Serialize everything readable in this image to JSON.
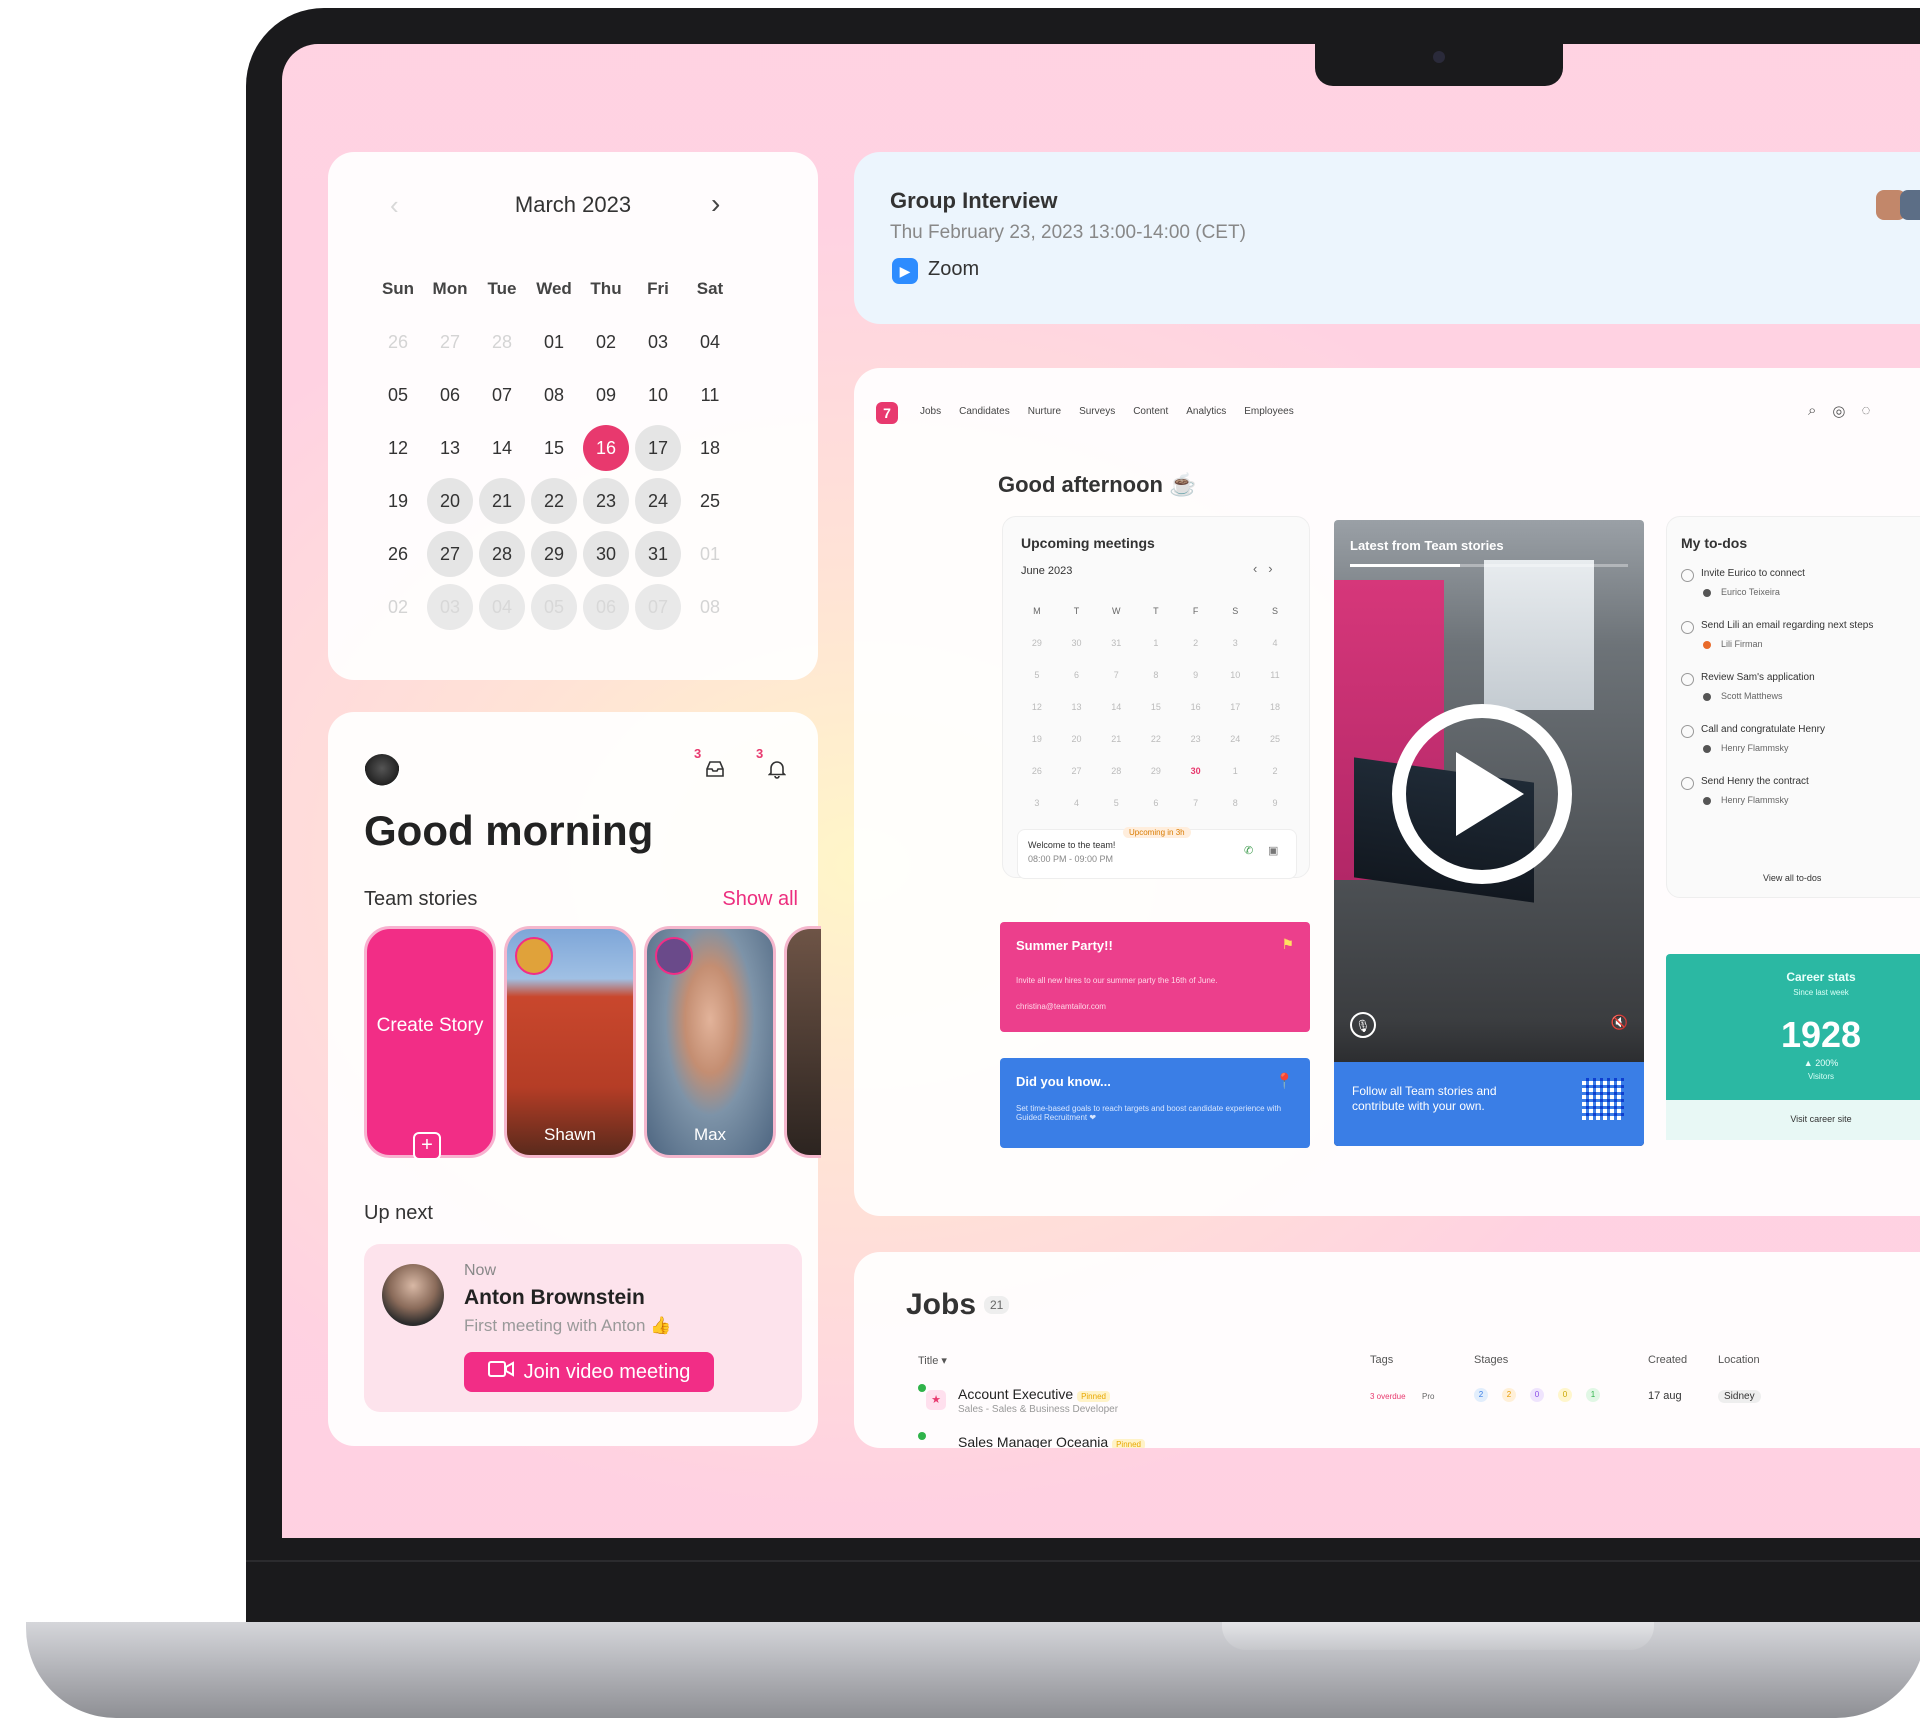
{
  "calendar": {
    "month": "March 2023",
    "weekdays": [
      "Sun",
      "Mon",
      "Tue",
      "Wed",
      "Thu",
      "Fri",
      "Sat"
    ],
    "weeks": [
      [
        "26",
        "27",
        "28",
        "01",
        "02",
        "03",
        "04"
      ],
      [
        "05",
        "06",
        "07",
        "08",
        "09",
        "10",
        "11"
      ],
      [
        "12",
        "13",
        "14",
        "15",
        "16",
        "17",
        "18"
      ],
      [
        "19",
        "20",
        "21",
        "22",
        "23",
        "24",
        "25"
      ],
      [
        "26",
        "27",
        "28",
        "29",
        "30",
        "31",
        "01"
      ],
      [
        "02",
        "03",
        "04",
        "05",
        "06",
        "07",
        "08"
      ]
    ],
    "selected": "16"
  },
  "home": {
    "notif_count_inbox": "3",
    "notif_count_bell": "3",
    "greeting": "Good morning",
    "stories_label": "Team stories",
    "show_all": "Show all",
    "create_story": "Create Story",
    "stories": [
      {
        "name": "Shawn"
      },
      {
        "name": "Max"
      }
    ],
    "up_next_label": "Up next",
    "up_next": {
      "when": "Now",
      "name": "Anton Brownstein",
      "subtitle": "First meeting with Anton 👍",
      "button": "Join video meeting"
    }
  },
  "meeting": {
    "title": "Group Interview",
    "time": "Thu February 23, 2023  13:00-14:00 (CET)",
    "platform": "Zoom"
  },
  "dashboard": {
    "logo": "7",
    "nav": [
      "Jobs",
      "Candidates",
      "Nurture",
      "Surveys",
      "Content",
      "Analytics",
      "Employees"
    ],
    "greeting": "Good afternoon ☕",
    "upcoming": {
      "title": "Upcoming meetings",
      "month": "June 2023",
      "weekdays": [
        "M",
        "T",
        "W",
        "T",
        "F",
        "S",
        "S"
      ],
      "weeks": [
        [
          "29",
          "30",
          "31",
          "1",
          "2",
          "3",
          "4"
        ],
        [
          "5",
          "6",
          "7",
          "8",
          "9",
          "10",
          "11"
        ],
        [
          "12",
          "13",
          "14",
          "15",
          "16",
          "17",
          "18"
        ],
        [
          "19",
          "20",
          "21",
          "22",
          "23",
          "24",
          "25"
        ],
        [
          "26",
          "27",
          "28",
          "29",
          "30",
          "1",
          "2"
        ],
        [
          "3",
          "4",
          "5",
          "6",
          "7",
          "8",
          "9"
        ]
      ],
      "highlight": "30",
      "badge": "Upcoming in 3h",
      "event_title": "Welcome to the team!",
      "event_time": "08:00 PM - 09:00 PM"
    },
    "summer": {
      "title": "Summer Party!!",
      "text": "Invite all new hires to our summer party the 16th of June.",
      "email": "christina@teamtailor.com"
    },
    "didyou": {
      "title": "Did you know...",
      "text": "Set time-based goals to reach targets and boost candidate experience with Guided Recruitment ❤"
    },
    "video": {
      "title": "Latest from Team stories",
      "footer": "Follow all Team stories and contribute with your own."
    },
    "todos": {
      "title": "My to-dos",
      "items": [
        {
          "text": "Invite Eurico to connect",
          "person": "Eurico Teixeira"
        },
        {
          "text": "Send Lili an email regarding next steps",
          "person": "Lili Firman"
        },
        {
          "text": "Review Sam's application",
          "person": "Scott Matthews"
        },
        {
          "text": "Call and congratulate Henry",
          "person": "Henry Flammsky"
        },
        {
          "text": "Send Henry the contract",
          "person": "Henry Flammsky"
        }
      ],
      "view_all": "View all to-dos"
    },
    "career": {
      "title": "Career stats",
      "subtitle": "Since last week",
      "value": "1928",
      "change": "▲ 200%",
      "unit": "Visitors",
      "link": "Visit career site"
    }
  },
  "jobs": {
    "title": "Jobs",
    "count": "21",
    "columns": [
      "Title ▾",
      "Tags",
      "Stages",
      "Created",
      "Location"
    ],
    "rows": [
      {
        "title": "Account Executive",
        "tag": "Pinned",
        "subtitle": "Sales - Sales & Business Developer",
        "tag1": "3 overdue",
        "tag2": "Pro",
        "stages": [
          "2",
          "2",
          "0",
          "0",
          "1"
        ],
        "created": "17 aug",
        "location": "Sidney"
      },
      {
        "title": "Sales Manager Oceania",
        "tag": "Pinned",
        "subtitle": "",
        "tag1": "",
        "tag2": "",
        "stages": [],
        "created": "",
        "location": ""
      }
    ]
  },
  "colors": {
    "accent": "#e8396e",
    "pink": "#f22d86",
    "blue": "#3a7ee6",
    "teal": "#2bb8a3"
  }
}
